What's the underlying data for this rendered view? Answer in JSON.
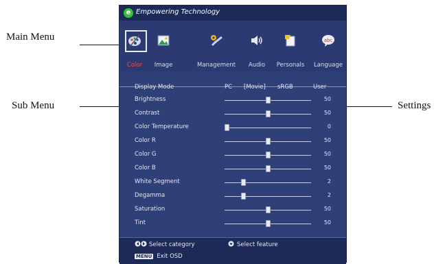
{
  "callouts": {
    "main_menu": "Main Menu",
    "sub_menu": "Sub Menu",
    "settings": "Settings"
  },
  "osd": {
    "brand": "Empowering Technology",
    "tabs": [
      {
        "label": "Color",
        "icon": "palette-icon",
        "active": true
      },
      {
        "label": "Image",
        "icon": "picture-icon",
        "active": false
      },
      {
        "label": "Management",
        "icon": "tools-icon",
        "active": false
      },
      {
        "label": "Audio",
        "icon": "speaker-icon",
        "active": false
      },
      {
        "label": "Personals",
        "icon": "document-icon",
        "active": false
      },
      {
        "label": "Language",
        "icon": "speech-bubble-icon",
        "active": false
      }
    ],
    "language_icon_text": "abc",
    "display_mode": {
      "label": "Display Mode",
      "options": [
        "PC",
        "[Movie]",
        "sRGB",
        "User"
      ]
    },
    "settings": [
      {
        "label": "Brightness",
        "value": "50",
        "level": 0.5
      },
      {
        "label": "Contrast",
        "value": "50",
        "level": 0.5
      },
      {
        "label": "Color Temperature",
        "value": "0",
        "level": 0.0
      },
      {
        "label": "Color R",
        "value": "50",
        "level": 0.5
      },
      {
        "label": "Color G",
        "value": "50",
        "level": 0.5
      },
      {
        "label": "Color B",
        "value": "50",
        "level": 0.5
      },
      {
        "label": "White Segment",
        "value": "2",
        "level": 0.2
      },
      {
        "label": "Degamma",
        "value": "2",
        "level": 0.2
      },
      {
        "label": "Saturation",
        "value": "50",
        "level": 0.5
      },
      {
        "label": "Tint",
        "value": "50",
        "level": 0.5
      }
    ],
    "footer": {
      "select_category": "Select category",
      "select_feature": "Select feature",
      "menu_key": "MENU",
      "exit_osd": "Exit OSD"
    }
  },
  "colors": {
    "osd_background": "#2f3f78",
    "active_tab_label": "#ff4a3a",
    "logo": "#34c23a"
  }
}
